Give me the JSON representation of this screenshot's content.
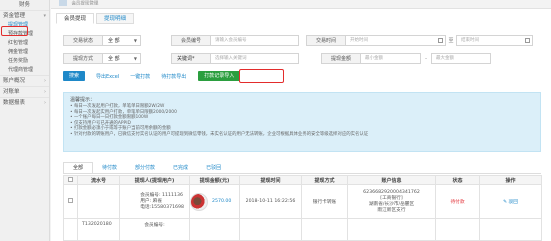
{
  "sidebar": {
    "top_label": "财务",
    "sections": [
      {
        "label": "资金管理",
        "items": [
          "提现管理",
          "预存款管理",
          "红包管理",
          "佣金管理",
          "任务奖励",
          "代理商管理"
        ]
      },
      {
        "label": "账户概况",
        "items": []
      },
      {
        "label": "对账单",
        "items": []
      },
      {
        "label": "数据报表",
        "items": []
      }
    ]
  },
  "breadcrumb": "会员提现管理",
  "tabs": [
    "会员提现",
    "提现明细"
  ],
  "filters": {
    "trade_status_label": "交易状态",
    "trade_status_value": "全 部",
    "member_no_label": "会员编号",
    "member_no_placeholder": "请输入会员编号",
    "trade_time_label": "交易时间",
    "start_placeholder": "开始时间",
    "range_sep": "至",
    "end_placeholder": "结束时间",
    "method_label": "提现方式",
    "method_value": "全 部",
    "keyword_label": "关键词*",
    "keyword_placeholder": "选择输入关键词",
    "amount_label": "提现金额",
    "min_placeholder": "最小金额",
    "max_placeholder": "最大金额"
  },
  "actions": {
    "search": "搜索",
    "export_excel": "导出Excel",
    "one_click_pay": "一键打款",
    "pending_export": "待打款导出",
    "import_records": "打款记录导入"
  },
  "info": {
    "title": "温馨提示：",
    "lines": [
      "每日一次发起用户打款，单笔单日限额2W/2W",
      "每日一次发起实用户打款，单笔单日限额2000/2000",
      "一个账户每日一日打款金额限额100W",
      "仅支持用户号已开通的APPID",
      "打款金额必须小于或等于账户当前可用余额的金额",
      "针对付款的转账用户，已微信支付实名认证的用户可提现到微信零钱，未实名认证的用户无法转账，企业可根据具体业务的安全等级选择对应的实名认证"
    ]
  },
  "subtabs": [
    "全部",
    "待付款",
    "部分付款",
    "已完成",
    "已驳回"
  ],
  "table": {
    "headers": [
      "",
      "流水号",
      "提现人(提现用户)",
      "提现金额(元)",
      "提现时间",
      "提现方式",
      "账户信息",
      "状态",
      "操作"
    ],
    "rows": [
      {
        "member_no": "会员编号: 1111136",
        "user_name": "用户: 麻雀",
        "phone": "电话:15580371698",
        "amount": "2570.00",
        "time": "2018-10-11 16:22:56",
        "method": "银行卡转账",
        "account_lines": [
          "6236682920004341762",
          "[工商银行]",
          "湖南省/长沙市/岳麓区",
          "雨江新区支行"
        ],
        "status": "待付款",
        "op": "✎ 驳回"
      },
      {
        "serial": "T132020180",
        "member_no": "会员编号:"
      }
    ]
  },
  "colors": {
    "accent": "#1e88c8",
    "green": "#2b9e3f",
    "highlight": "#e32c2c"
  }
}
